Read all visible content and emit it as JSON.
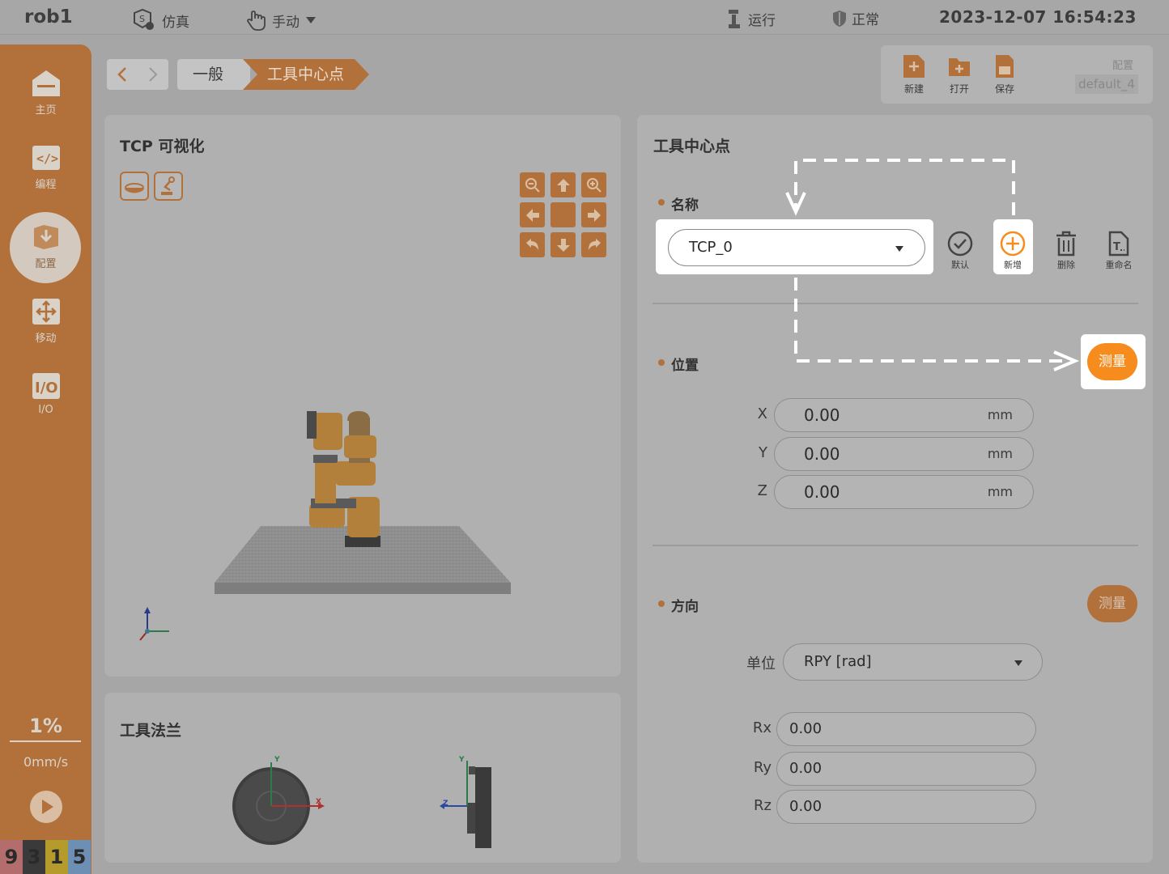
{
  "topbar": {
    "robot_name": "rob1",
    "sim_label": "仿真",
    "mode_label": "手动",
    "run_label": "运行",
    "status_label": "正常",
    "datetime": "2023-12-07 16:54:23"
  },
  "sidebar": {
    "items": [
      {
        "label": "主页",
        "icon": "home-icon"
      },
      {
        "label": "编程",
        "icon": "code-icon"
      },
      {
        "label": "配置",
        "icon": "config-icon"
      },
      {
        "label": "移动",
        "icon": "move-icon"
      },
      {
        "label": "I/O",
        "icon": "io-icon"
      }
    ],
    "speed_percent": "1%",
    "speed_mm": "0mm/s",
    "digits": [
      "9",
      "3",
      "1",
      "5"
    ],
    "digit_colors": [
      "#b36d6d",
      "#3a3a3a",
      "#b59a2c",
      "#6d8fb3"
    ]
  },
  "breadcrumb": {
    "items": [
      "一般",
      "工具中心点"
    ]
  },
  "config_panel": {
    "new_label": "新建",
    "open_label": "打开",
    "save_label": "保存",
    "config_label": "配置",
    "config_value": "default_4"
  },
  "tcp_visual": {
    "title": "TCP 可视化"
  },
  "tool_flange": {
    "title": "工具法兰",
    "front_axes": {
      "x": "X",
      "y": "Y"
    },
    "side_axes": {
      "y": "Y",
      "z": "Z"
    }
  },
  "tcp_form": {
    "title": "工具中心点",
    "name_section": "名称",
    "name_value": "TCP_0",
    "actions": {
      "default": "默认",
      "add": "新增",
      "delete": "删除",
      "rename": "重命名"
    },
    "position_section": "位置",
    "measure_label": "测量",
    "position": [
      {
        "axis": "X",
        "value": "0.00",
        "unit": "mm"
      },
      {
        "axis": "Y",
        "value": "0.00",
        "unit": "mm"
      },
      {
        "axis": "Z",
        "value": "0.00",
        "unit": "mm"
      }
    ],
    "orientation_section": "方向",
    "orientation_measure_label": "测量",
    "unit_label": "单位",
    "unit_value": "RPY [rad]",
    "orientation": [
      {
        "axis": "Rx",
        "value": "0.00"
      },
      {
        "axis": "Ry",
        "value": "0.00"
      },
      {
        "axis": "Rz",
        "value": "0.00"
      }
    ]
  },
  "colors": {
    "accent": "#f68c1e",
    "accent_dim": "#b2713b",
    "panel": "#b0b0b0",
    "background": "#a6a6a6"
  }
}
